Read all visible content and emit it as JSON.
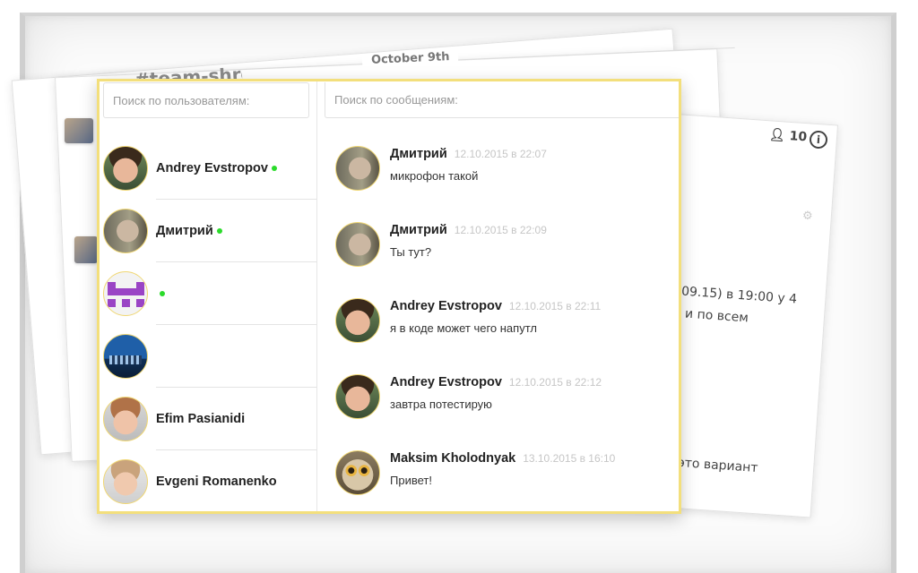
{
  "background": {
    "channel_title": "#team-shre",
    "date_divider": "October 9th",
    "member_count": "10",
    "info_icon": "info-icon",
    "snippet_1": "09.15) в 19:00 у 4",
    "snippet_2": "и по всем",
    "snippet_3": "это вариант"
  },
  "users_panel": {
    "search_placeholder": "Поиск по пользователям:",
    "users": [
      {
        "name": "Andrey Evstropov",
        "online": true,
        "avatar": "avatar-andrey"
      },
      {
        "name": "Дмитрий",
        "online": true,
        "avatar": "avatar-dmitry"
      },
      {
        "name": "",
        "online": true,
        "avatar": "avatar-pixel-identicon"
      },
      {
        "name": "",
        "online": false,
        "avatar": "avatar-city-skyline"
      },
      {
        "name": "Efim Pasianidi",
        "online": false,
        "avatar": "avatar-efim"
      },
      {
        "name": "Evgeni Romanenko",
        "online": false,
        "avatar": "avatar-evgeni"
      }
    ]
  },
  "messages_panel": {
    "search_placeholder": "Поиск по сообщениям:",
    "messages": [
      {
        "author": "Дмитрий",
        "time": "12.10.2015 в 22:07",
        "text": "микрофон такой",
        "avatar": "avatar-dmitry"
      },
      {
        "author": "Дмитрий",
        "time": "12.10.2015 в 22:09",
        "text": "Ты тут?",
        "avatar": "avatar-dmitry"
      },
      {
        "author": "Andrey Evstropov",
        "time": "12.10.2015 в 22:11",
        "text": "я в коде может чего напутл",
        "avatar": "avatar-andrey"
      },
      {
        "author": "Andrey Evstropov",
        "time": "12.10.2015 в 22:12",
        "text": "завтра потестирую",
        "avatar": "avatar-andrey"
      },
      {
        "author": "Maksim Kholodnyak",
        "time": "13.10.2015 в 16:10",
        "text": "Привет!",
        "avatar": "avatar-owl"
      }
    ]
  },
  "colors": {
    "panel_border": "#f3df7c",
    "online": "#2bdb2b",
    "timestamp": "#c6c6c6"
  }
}
